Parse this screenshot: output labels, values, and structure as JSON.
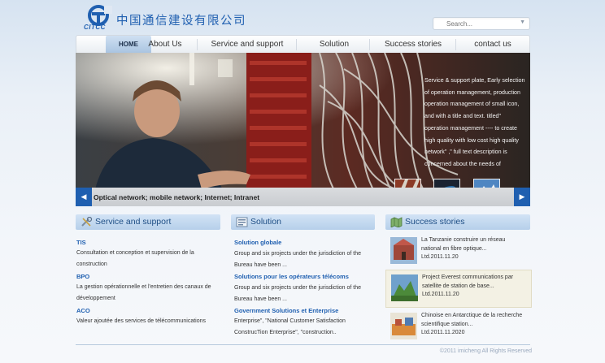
{
  "header": {
    "logo_text": "CITCC",
    "company_name": "中国通信建设有限公司",
    "search_placeholder": "Search..."
  },
  "nav": {
    "items": [
      {
        "label": "HOME",
        "active": true
      },
      {
        "label": "About Us"
      },
      {
        "label": "Service and support"
      },
      {
        "label": "Solution"
      },
      {
        "label": "Success stories"
      },
      {
        "label": "contact us"
      }
    ]
  },
  "banner": {
    "text": "Service & support plate, Early selection of operation management, production operation management of small icon, and with a title and text. titled\" operation management ---- to create high quality with low cost high quality network\" ,\" full text description is concerned about the needs of",
    "caption": "Optical network; mobile network; Internet; Intranet",
    "prev_icon": "chevron-left-icon",
    "next_icon": "chevron-right-icon"
  },
  "service": {
    "title": "Service and support",
    "items": [
      {
        "head": "TIS",
        "lines": [
          "Consultation et conception et supervision de la",
          "construction"
        ]
      },
      {
        "head": "BPO",
        "lines": [
          "La gestion opérationnelle et l'entretien des canaux de",
          "développement"
        ]
      },
      {
        "head": "ACO",
        "lines": [
          "Valeur ajoutée des services de télécommunications"
        ]
      }
    ]
  },
  "solution": {
    "title": "Solution",
    "items": [
      {
        "head": "Solution globale",
        "lines": [
          "Group and six projects under the jurisdiction of the",
          "Bureau have been ..."
        ]
      },
      {
        "head": "Solutions pour les opérateurs télécoms",
        "lines": [
          "Group and six projects under the jurisdiction of the",
          "Bureau have been ..."
        ]
      },
      {
        "head": "Government Solutions et Enterprise",
        "lines": [
          "Enterprise\", \"National Customer Satisfaction",
          "ConstrucTion Enterprise\", \"construction.."
        ]
      }
    ]
  },
  "stories": {
    "title": "Success stories",
    "items": [
      {
        "lines": [
          "La Tanzanie construire un réseau",
          "national en fibre optique...",
          "Ltd.2011.11.20"
        ]
      },
      {
        "lines": [
          "Project Everest communications par",
          "satellite de station de base...",
          "Ltd.2011.11.20"
        ]
      },
      {
        "lines": [
          "Chinoise en Antarctique de la recherche",
          "scientifique station...",
          "Ltd.2011.11.2020"
        ]
      }
    ]
  },
  "footer": {
    "copyright": "©2011 imicheng All Rights Reserved"
  },
  "colors": {
    "brand_blue": "#1f5fb0",
    "nav_active": "#a8c3e0",
    "heading_bar": "#b6cfea"
  }
}
